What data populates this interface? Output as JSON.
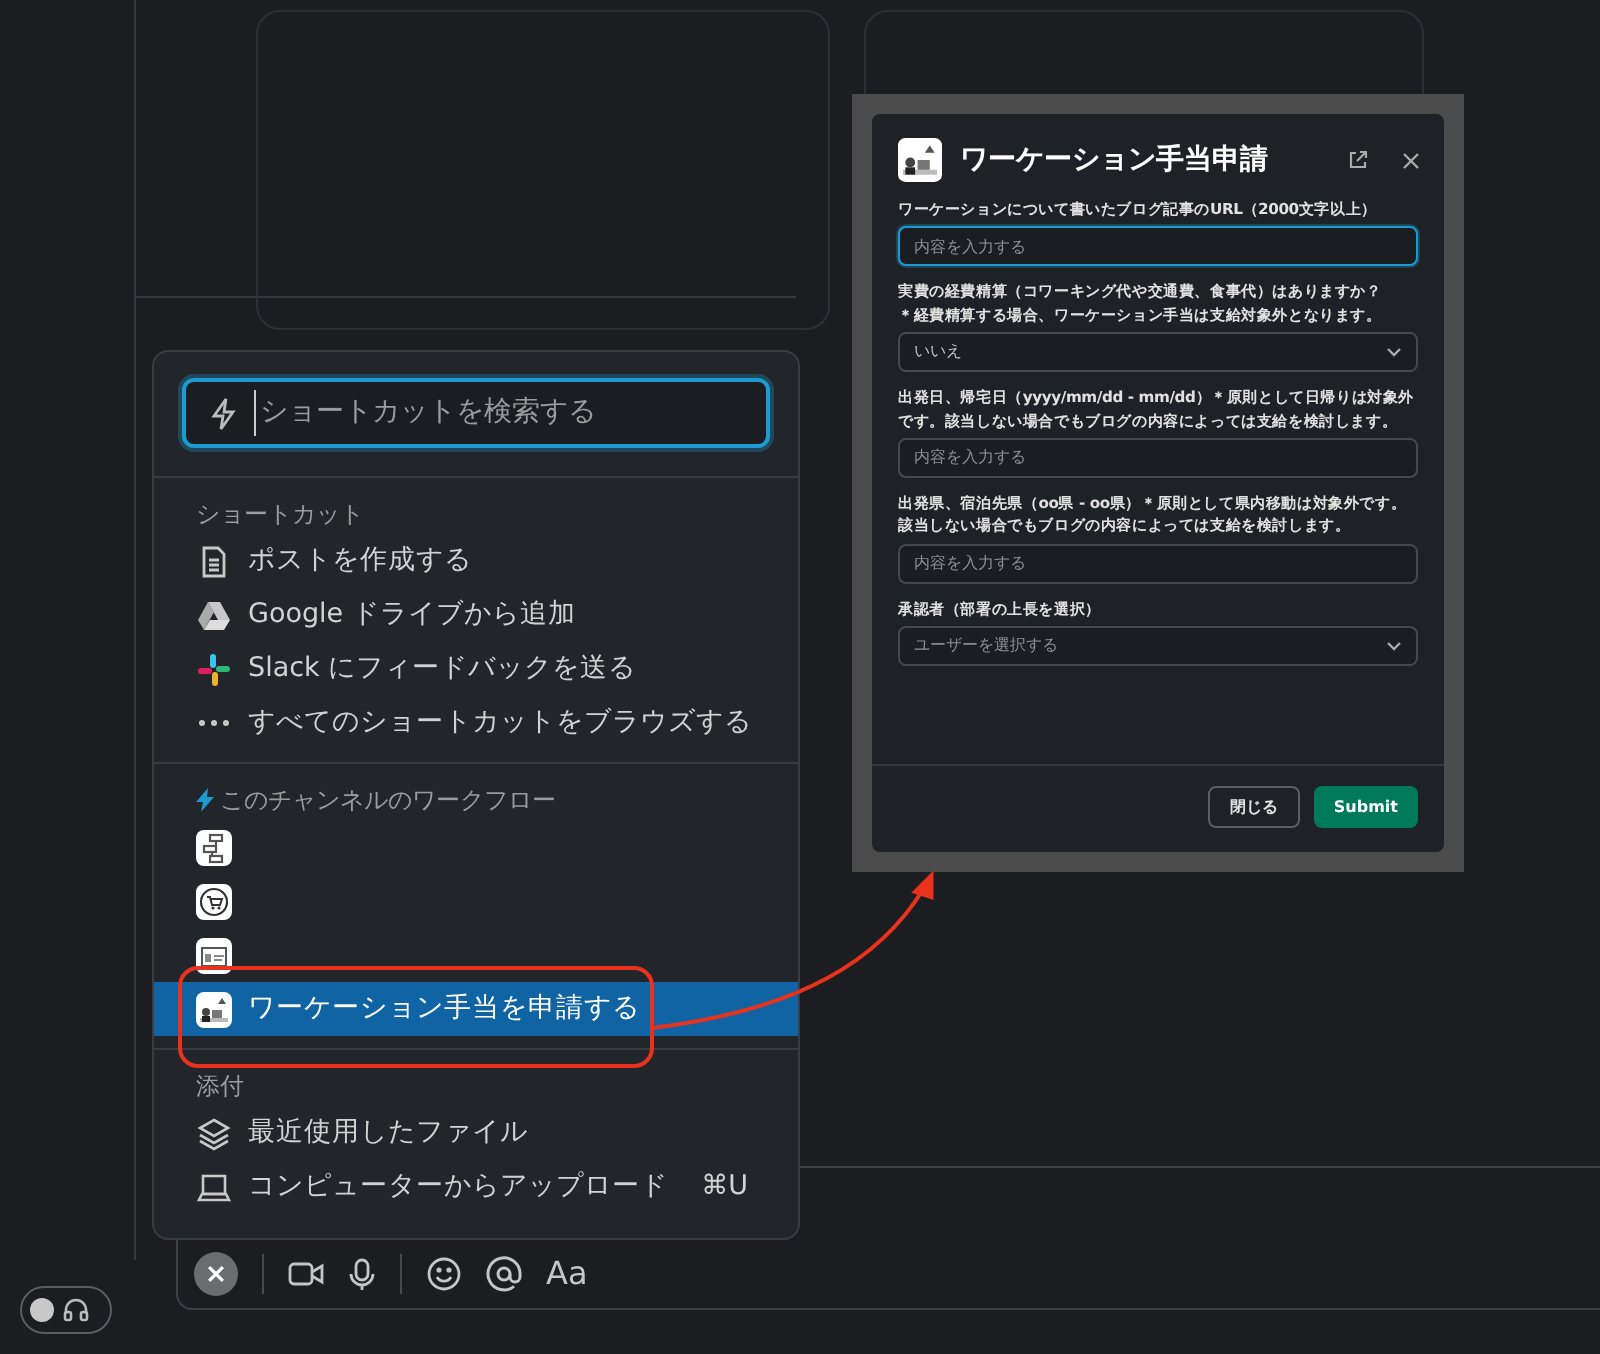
{
  "shortcut_menu": {
    "search": {
      "placeholder": "ショートカットを検索する",
      "focused": true
    },
    "sections": [
      {
        "kind": "plain",
        "title": "ショートカット",
        "items": [
          {
            "kind": "document",
            "label": "ポストを作成する",
            "selected": false
          },
          {
            "kind": "drive",
            "label": "Google ドライブから追加",
            "selected": false
          },
          {
            "kind": "slack",
            "label": "Slack にフィードバックを送る",
            "selected": false
          },
          {
            "kind": "more",
            "label": "すべてのショートカットをブラウズする",
            "selected": false
          }
        ]
      },
      {
        "kind": "workflows",
        "title": "このチャンネルのワークフロー",
        "items": [
          {
            "kind": "flowchart",
            "selected": false
          },
          {
            "kind": "cart",
            "selected": false
          },
          {
            "kind": "card",
            "selected": false
          },
          {
            "kind": "picture",
            "label": "ワーケーション手当を申請する",
            "selected": true
          }
        ]
      },
      {
        "kind": "plain",
        "title": "添付",
        "items": [
          {
            "kind": "layers",
            "label": "最近使用したファイル",
            "selected": false
          },
          {
            "kind": "laptop",
            "label": "コンピューターからアップロード",
            "hint": "⌘U",
            "selected": false
          }
        ]
      }
    ]
  },
  "modal": {
    "title": "ワーケーション手当申請",
    "fields": [
      {
        "kind": "text",
        "label": "ワーケーションについて書いたブログ記事のURL（2000文字以上）",
        "placeholder": "内容を入力する",
        "focused": true
      },
      {
        "kind": "select",
        "label": "実費の経費精算（コワーキング代や交通費、食事代）はありますか？",
        "note": "＊経費精算する場合、ワーケーション手当は支給対象外となります。",
        "value": "いいえ"
      },
      {
        "kind": "text",
        "label": "出発日、帰宅日（yyyy/mm/dd - mm/dd）＊原則として日帰りは対象外です。該当しない場合でもブログの内容によっては支給を検討します。",
        "placeholder": "内容を入力する",
        "focused": false
      },
      {
        "kind": "text",
        "label": "出発県、宿泊先県（oo県 - oo県）＊原則として県内移動は対象外です。該当しない場合でもブログの内容によっては支給を検討します。",
        "placeholder": "内容を入力する",
        "focused": false
      },
      {
        "kind": "select",
        "label": "承認者（部署の上長を選択）",
        "placeholder": "ユーザーを選択する"
      }
    ],
    "buttons": [
      {
        "kind": "secondary",
        "label": "閉じる"
      },
      {
        "kind": "primary",
        "label": "Submit"
      }
    ]
  },
  "composer": {
    "format_label": "Aa"
  },
  "huddle_toggle": {
    "on": false
  }
}
